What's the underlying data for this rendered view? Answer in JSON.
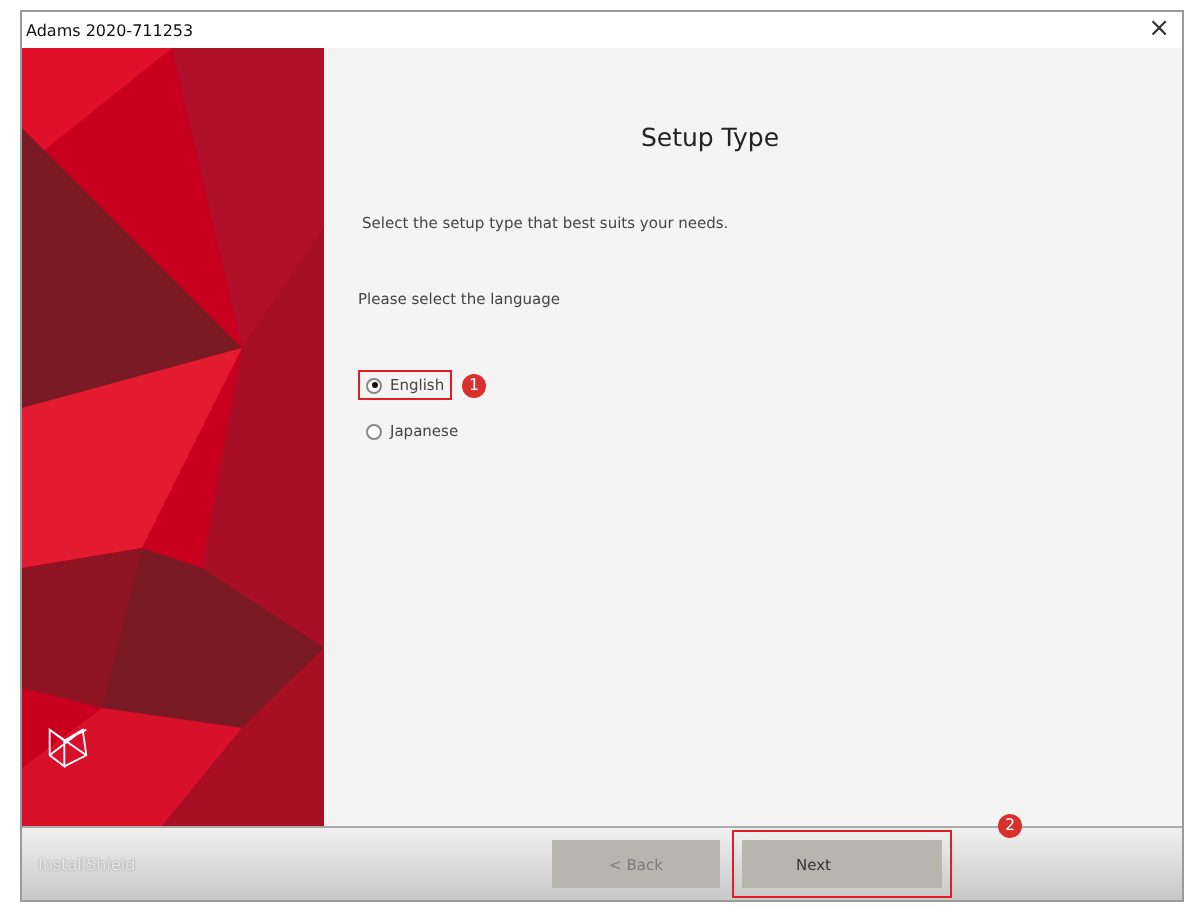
{
  "window": {
    "title": "Adams 2020-711253",
    "close": "×"
  },
  "page": {
    "title": "Setup Type",
    "description": "Select the setup type that best suits your needs.",
    "prompt": "Please select the language"
  },
  "languages": [
    {
      "label": "English",
      "selected": true,
      "annotation": "1"
    },
    {
      "label": "Japanese",
      "selected": false
    }
  ],
  "footer": {
    "brand": "InstallShield"
  },
  "buttons": [
    {
      "label": "< Back",
      "disabled": true
    },
    {
      "label": "Next",
      "disabled": false,
      "annotation": "2"
    }
  ]
}
